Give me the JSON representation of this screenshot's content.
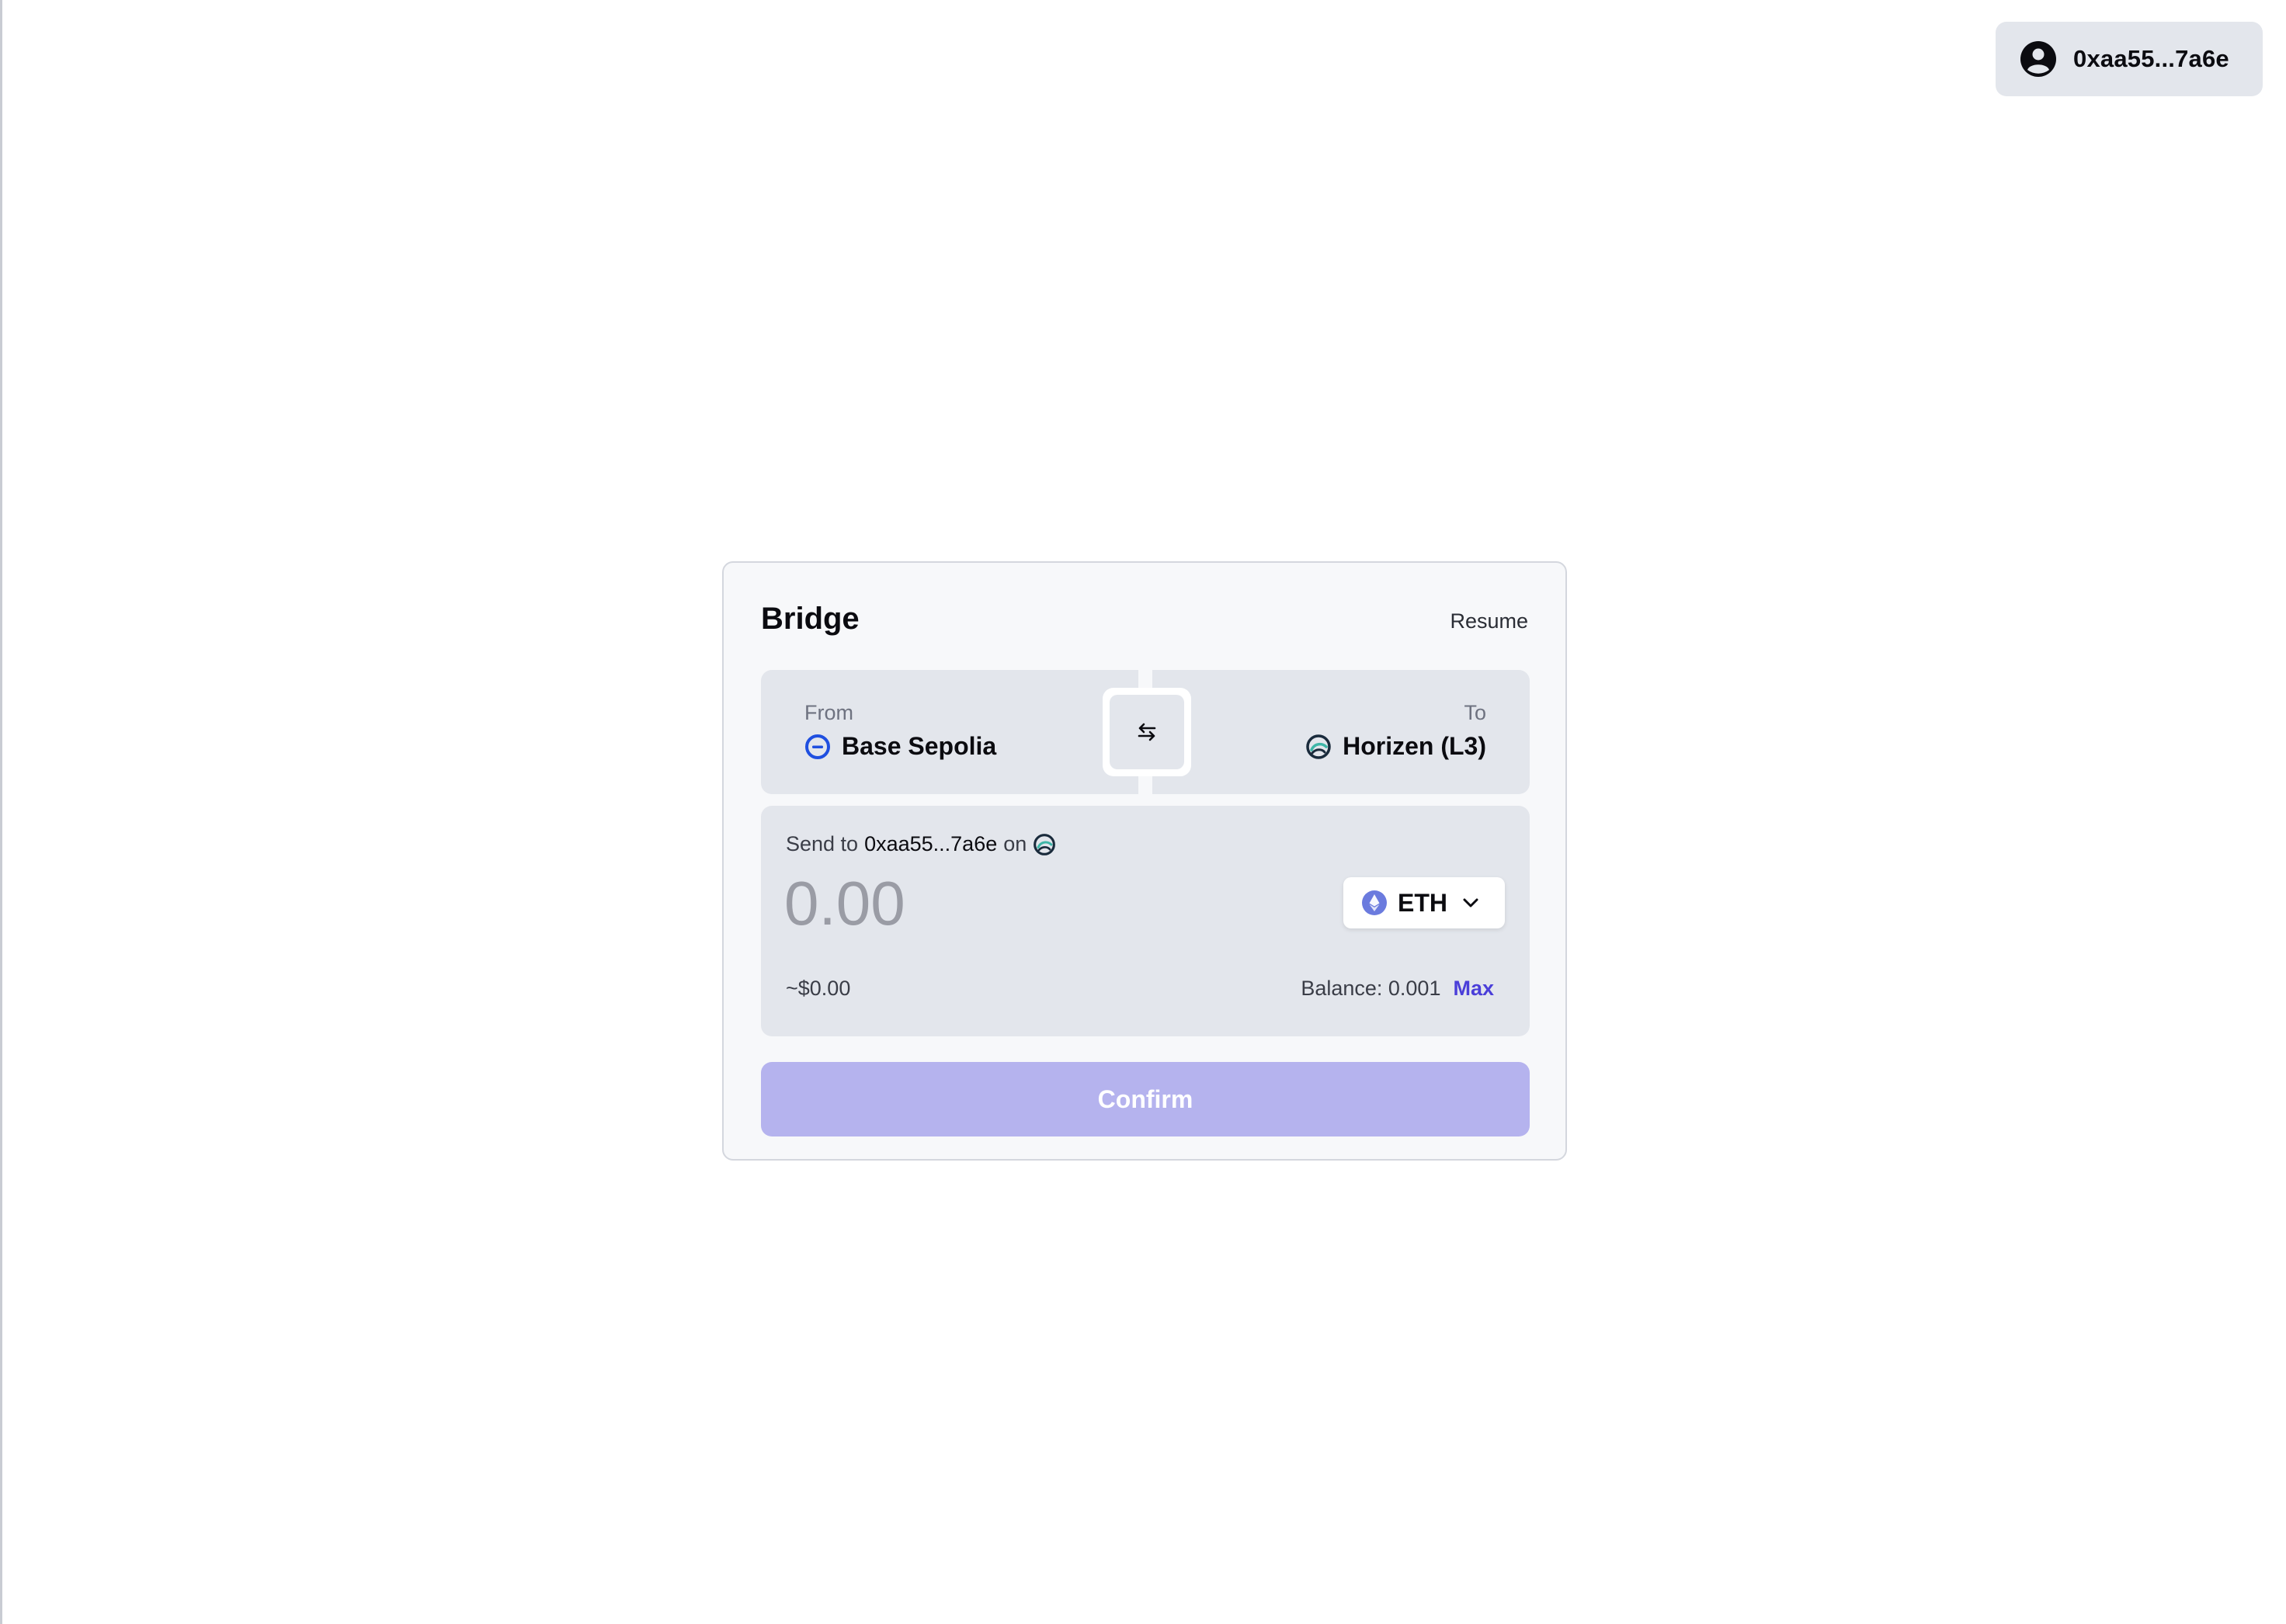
{
  "account": {
    "address": "0xaa55...7a6e",
    "icon": "user-circle-icon"
  },
  "bridge": {
    "title": "Bridge",
    "resume_label": "Resume",
    "from": {
      "caption": "From",
      "chain": "Base Sepolia",
      "icon": "base-sepolia-icon"
    },
    "to": {
      "caption": "To",
      "chain": "Horizen (L3)",
      "icon": "horizen-icon"
    },
    "swap_icon": "swap-arrows-icon",
    "send": {
      "prefix": "Send to",
      "recipient": "0xaa55...7a6e",
      "on_word": "on"
    },
    "amount": {
      "value": "",
      "placeholder": "0.00"
    },
    "token": {
      "symbol": "ETH",
      "icon": "eth-icon"
    },
    "usd_value": "~$0.00",
    "balance_label": "Balance: 0.001",
    "max_label": "Max",
    "confirm_label": "Confirm"
  },
  "colors": {
    "accent": "#4b3fd9",
    "confirm_disabled": "#b5b3ee",
    "panel": "#e3e6ec",
    "card": "#f7f8fa",
    "base_blue": "#1f4fe0",
    "eth_purple": "#6b7bde",
    "horizen_teal": "#3fb6a8"
  }
}
